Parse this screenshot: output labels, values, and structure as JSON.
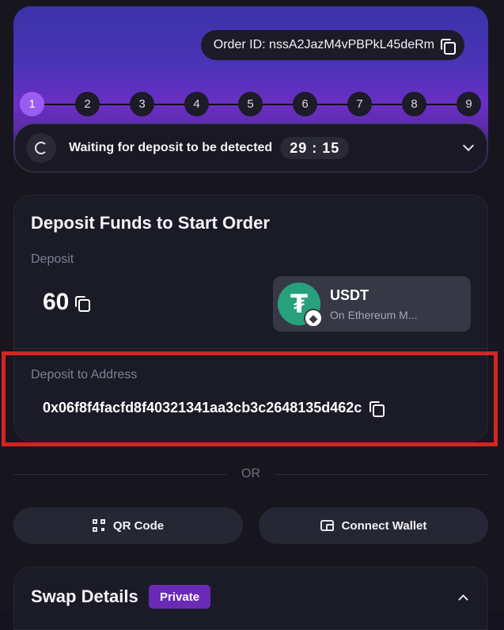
{
  "order": {
    "label": "Order ID: nssA2JazM4vPBPkL45deRm"
  },
  "steps": [
    "1",
    "2",
    "3",
    "4",
    "5",
    "6",
    "7",
    "8",
    "9"
  ],
  "active_step": "1",
  "status": {
    "text": "Waiting for deposit to be detected",
    "timer": "29 : 15"
  },
  "deposit": {
    "title": "Deposit Funds to Start Order",
    "amount_label": "Deposit",
    "amount": "60",
    "token_symbol": "USDT",
    "token_network": "On Ethereum M...",
    "address_label": "Deposit to Address",
    "address": "0x06f8f4facfd8f40321341aa3cb3c2648135d462c"
  },
  "separator": "OR",
  "actions": {
    "qr_label": "QR Code",
    "wallet_label": "Connect Wallet"
  },
  "swap": {
    "title": "Swap Details",
    "badge": "Private"
  },
  "colors": {
    "accent": "#9b5cf2",
    "token": "#26a17b",
    "highlight": "#d42424",
    "badge": "#6a2ab6"
  },
  "icons": [
    "copy-icon",
    "spinner-icon",
    "chevron-down-icon",
    "tether-icon",
    "ethereum-icon",
    "qr-code-icon",
    "wallet-icon",
    "chevron-up-icon"
  ]
}
